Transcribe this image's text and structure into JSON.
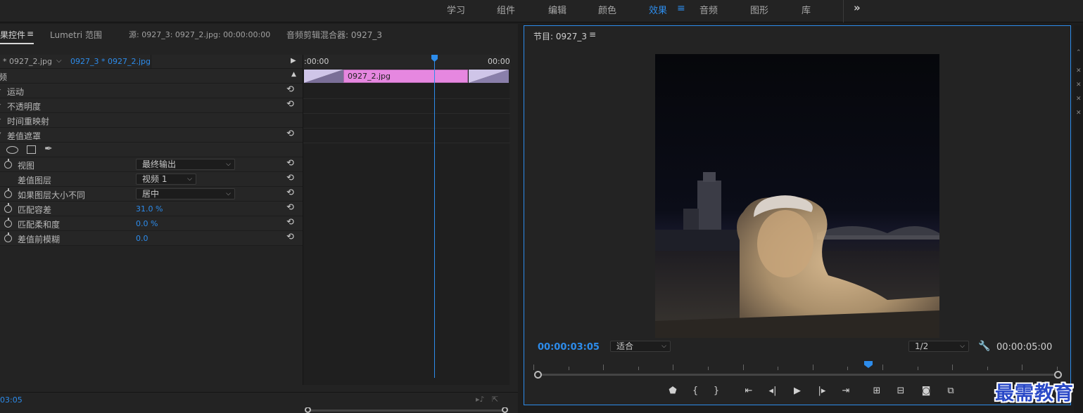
{
  "workspaces": {
    "items": [
      {
        "label": "学习"
      },
      {
        "label": "组件"
      },
      {
        "label": "编辑"
      },
      {
        "label": "颜色"
      },
      {
        "label": "效果"
      },
      {
        "label": "音频"
      },
      {
        "label": "图形"
      },
      {
        "label": "库"
      }
    ],
    "active": "效果",
    "overflow": "»"
  },
  "left_panel": {
    "tabs": {
      "effect_controls": "果控件",
      "effect_controls_menu": "≡",
      "lumetri": "Lumetri 范围",
      "source": "源: 0927_3: 0927_2.jpg: 00:00:00:00",
      "audio_mixer": "音频剪辑混合器: 0927_3"
    },
    "clip": {
      "master": "* 0927_2.jpg",
      "sequence": "0927_3 * 0927_2.jpg"
    },
    "section": "频",
    "properties": {
      "motion": "运动",
      "opacity": "不透明度",
      "time_remap": "时间重映射",
      "diff_matte": "差值遮罩",
      "view": {
        "label": "视图",
        "value": "最终输出"
      },
      "diff_layer": {
        "label": "差值图层",
        "value": "视频 1"
      },
      "if_size_differs": {
        "label": "如果图层大小不同",
        "value": "居中"
      },
      "match_tolerance": {
        "label": "匹配容差",
        "value": "31.0 %"
      },
      "match_softness": {
        "label": "匹配柔和度",
        "value": "0.0 %"
      },
      "blur_before_diff": {
        "label": "差值前模糊",
        "value": "0.0"
      }
    },
    "timeline": {
      "start": ":00:00",
      "end": "00:00",
      "clip_label": "0927_2.jpg"
    },
    "current_time": "03:05"
  },
  "program": {
    "title": "节目: 0927_3",
    "menu": "≡",
    "timecode_current": "00:00:03:05",
    "timecode_total": "00:00:05:00",
    "fit": "适合",
    "resolution": "1/2",
    "playhead_fraction": 0.64
  },
  "watermark": "最需教育",
  "colors": {
    "accent": "#2d8ceb",
    "clip": "#e687e0"
  }
}
